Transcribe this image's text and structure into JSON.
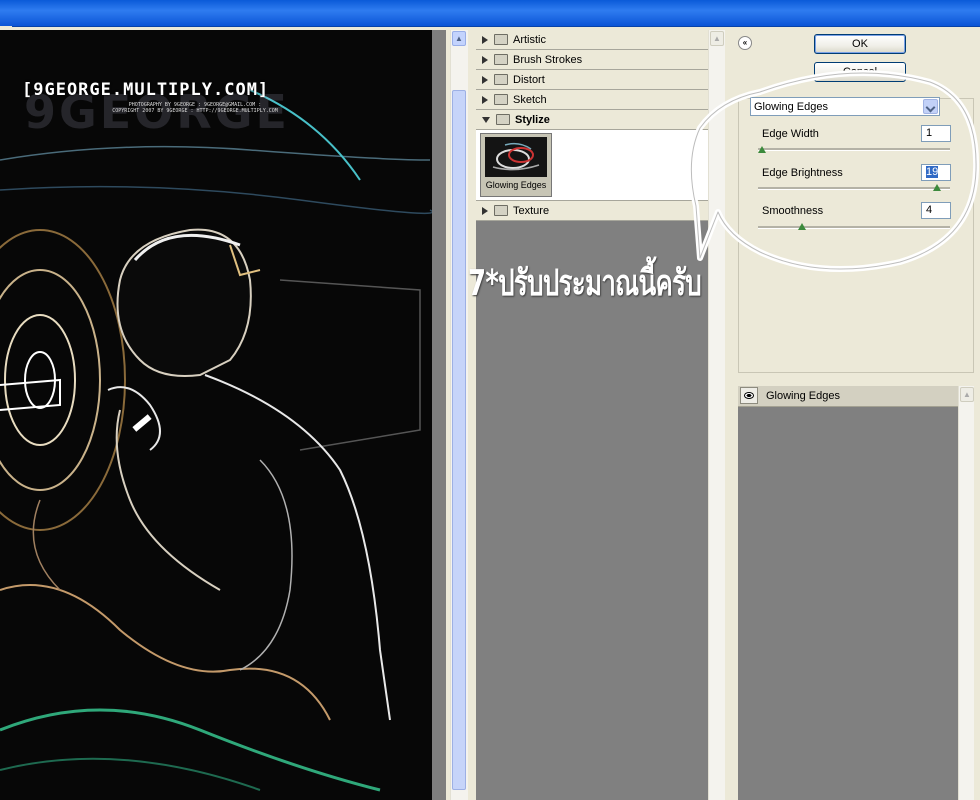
{
  "watermark": {
    "main": "[9GEORGE.MULTIPLY.COM]",
    "sub1": "PHOTOGRAPHY BY 9GEORGE : 9GEORGE@GMAIL.COM :",
    "sub2": "COPYRIGHT 2007 BY 9GEORGE : HTTP://9GEORGE.MULTIPLY.COM",
    "big": "9GEORGE"
  },
  "gallery": {
    "categories": [
      {
        "label": "Artistic",
        "open": false
      },
      {
        "label": "Brush Strokes",
        "open": false
      },
      {
        "label": "Distort",
        "open": false
      },
      {
        "label": "Sketch",
        "open": false
      },
      {
        "label": "Stylize",
        "open": true
      },
      {
        "label": "Texture",
        "open": false
      }
    ],
    "thumb_label": "Glowing Edges"
  },
  "buttons": {
    "ok": "OK",
    "cancel": "Cancel"
  },
  "filter_select": "Glowing Edges",
  "params": [
    {
      "label": "Edge Width",
      "value": "1",
      "slider_fraction": 0.0
    },
    {
      "label": "Edge Brightness",
      "value": "19",
      "slider_fraction": 0.9
    },
    {
      "label": "Smoothness",
      "value": "4",
      "slider_fraction": 0.2
    }
  ],
  "layer": {
    "label": "Glowing Edges"
  },
  "annotation": "7*ปรับประมาณนี้ครับ",
  "colors": {
    "accent_blue": "#316ac5",
    "titlebar": "#0a5ad8",
    "knob_green": "#3c8a3c"
  }
}
